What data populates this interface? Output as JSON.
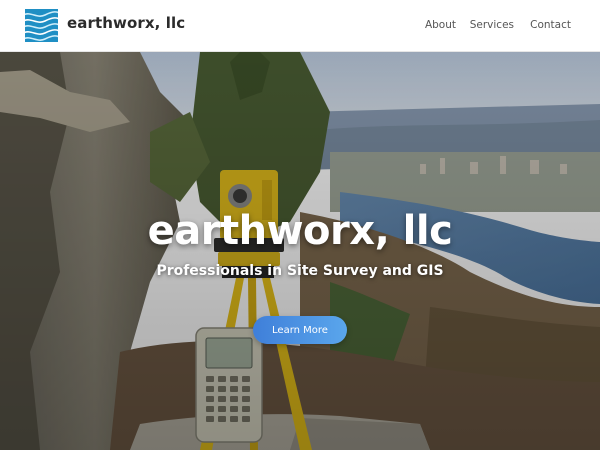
{
  "header": {
    "brand": "earthworx, llc",
    "logo_icon": "wave-logo-icon",
    "nav": [
      {
        "label": "About"
      },
      {
        "label": "Services"
      },
      {
        "label": "Contact"
      }
    ]
  },
  "hero": {
    "title": "earthworx, llc",
    "subtitle": "Professionals in Site Survey and GIS",
    "cta_label": "Learn More",
    "background": "survey-instrument-overlooking-river-photo"
  },
  "colors": {
    "logo_bg": "#1f8fc4",
    "cta_start": "#3f7fd9",
    "cta_end": "#5aa6ec",
    "tripod": "#e8c21a"
  }
}
